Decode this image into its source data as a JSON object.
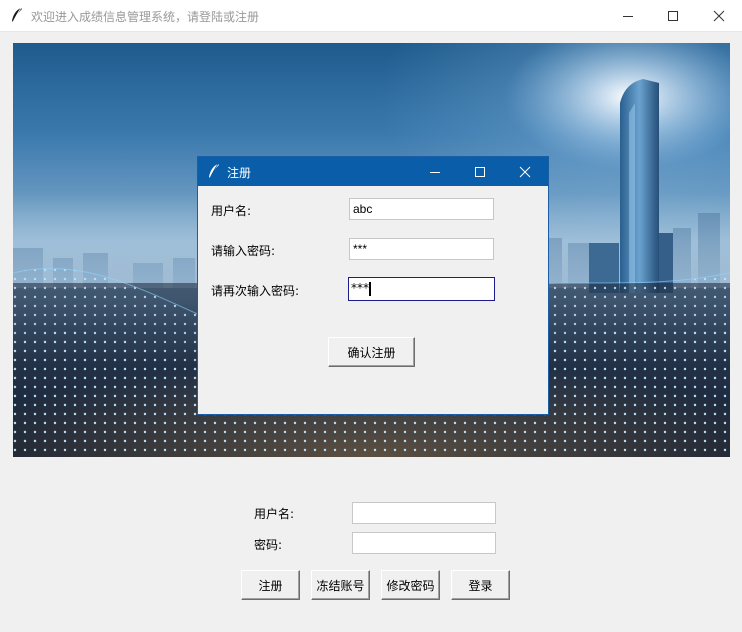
{
  "main_window": {
    "title": "欢迎进入成绩信息管理系统，请登陆或注册",
    "controls": {
      "minimize": "minimize-icon",
      "maximize": "maximize-icon",
      "close": "close-icon"
    }
  },
  "login_form": {
    "username_label": "用户名:",
    "username_value": "",
    "password_label": "密码:",
    "password_value": "",
    "buttons": {
      "register": "注册",
      "freeze": "冻结账号",
      "change_password": "修改密码",
      "login": "登录"
    }
  },
  "register_dialog": {
    "title": "注册",
    "username_label": "用户名:",
    "username_value": "abc",
    "password_label": "请输入密码:",
    "password_value": "***",
    "confirm_label": "请再次输入密码:",
    "confirm_value": "***",
    "submit_label": "确认注册"
  },
  "colors": {
    "dialog_titlebar": "#0a5da8",
    "window_bg": "#f0f0f0"
  }
}
